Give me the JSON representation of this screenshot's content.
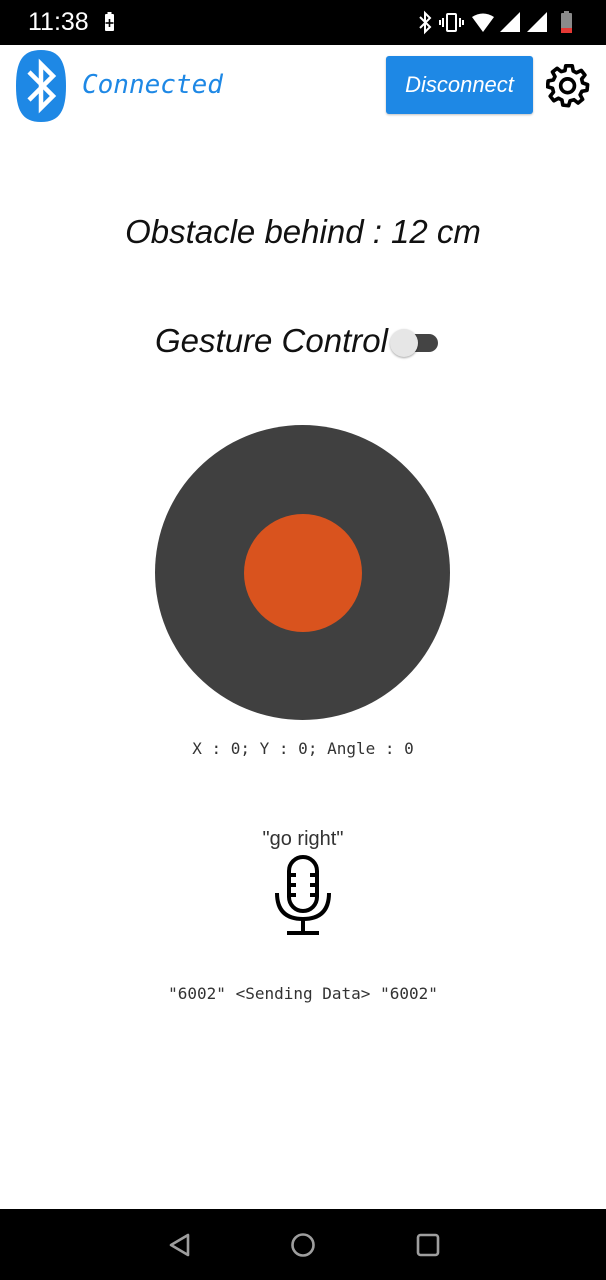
{
  "status_bar": {
    "time": "11:38",
    "icons": [
      "battery-saver-icon",
      "bluetooth-icon",
      "vibrate-icon",
      "wifi-icon",
      "cell-signal-icon",
      "cell-signal-icon",
      "battery-low-icon"
    ]
  },
  "header": {
    "connection_status": "Connected",
    "disconnect_label": "Disconnect",
    "status_color": "#1e88e5"
  },
  "obstacle": {
    "text": "Obstacle behind : 12 cm"
  },
  "gesture": {
    "label": "Gesture Control",
    "enabled": false
  },
  "joystick": {
    "readout": "X : 0; Y : 0; Angle : 0",
    "base_color": "#404040",
    "knob_color": "#d9531e"
  },
  "voice": {
    "last_command": "\"go right\""
  },
  "log": {
    "text": "\"6002\" <Sending Data> \"6002\""
  },
  "nav": {
    "buttons": [
      "back-icon",
      "home-icon",
      "recents-icon"
    ]
  }
}
